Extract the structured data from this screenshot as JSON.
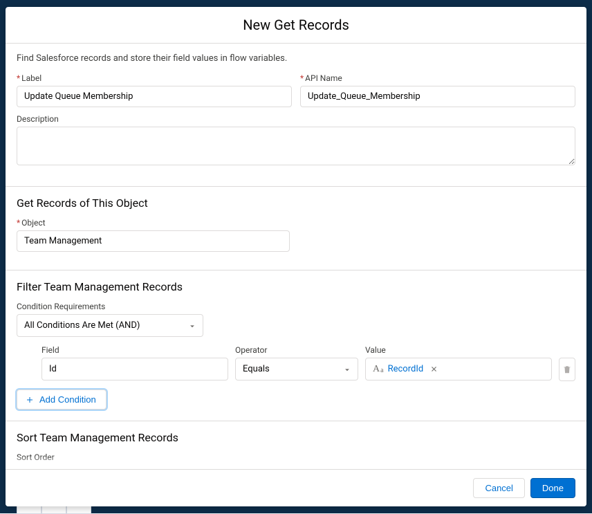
{
  "modal": {
    "title": "New Get Records",
    "intro": "Find Salesforce records and store their field values in flow variables."
  },
  "basic": {
    "label_label": "Label",
    "label_value": "Update Queue Membership",
    "apiname_label": "API Name",
    "apiname_value": "Update_Queue_Membership",
    "description_label": "Description",
    "description_value": ""
  },
  "object_section": {
    "title": "Get Records of This Object",
    "object_label": "Object",
    "object_value": "Team Management"
  },
  "filter_section": {
    "title": "Filter Team Management Records",
    "condition_req_label": "Condition Requirements",
    "condition_req_value": "All Conditions Are Met (AND)",
    "cols": {
      "field": "Field",
      "operator": "Operator",
      "value": "Value"
    },
    "row": {
      "field": "Id",
      "operator": "Equals",
      "value": "RecordId"
    },
    "add_condition": "Add Condition"
  },
  "sort_section": {
    "title": "Sort Team Management Records",
    "sort_order_label": "Sort Order"
  },
  "footer": {
    "cancel": "Cancel",
    "done": "Done"
  }
}
